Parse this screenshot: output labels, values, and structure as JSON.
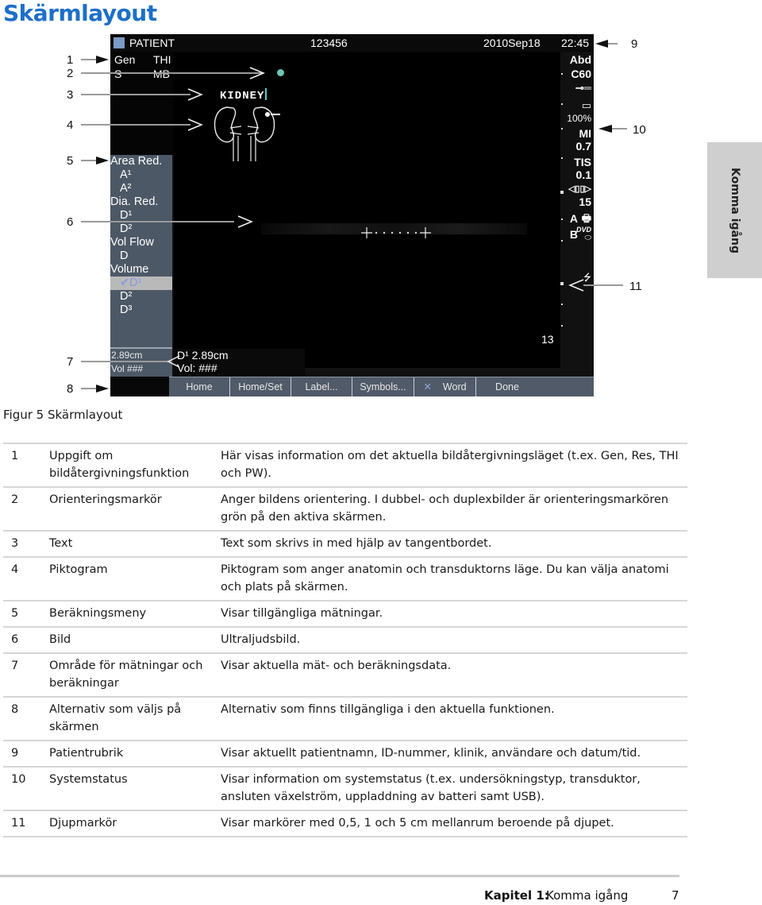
{
  "page": {
    "title": "Skärmlayout",
    "side_tab": "Komma igång",
    "figure_caption": "Figur 5  Skärmlayout",
    "footer": {
      "chapter_label": "Kapitel 1:",
      "chapter_title": "Komma igång",
      "page_number": "7"
    }
  },
  "callouts": [
    "1",
    "2",
    "3",
    "4",
    "5",
    "6",
    "7",
    "8",
    "9",
    "10",
    "11"
  ],
  "screen": {
    "header": {
      "patient": "PATIENT",
      "id": "123456",
      "date": "2010Sep18",
      "time": "22:45"
    },
    "mode_info": {
      "row1": [
        "Gen",
        "THI"
      ],
      "row2": [
        "S",
        "MB"
      ]
    },
    "text_annotation": "KIDNEY",
    "orientation_marker_color": "#6cc8b4",
    "calc_menu": [
      {
        "label": "Area Red.",
        "sub": false,
        "selected": false
      },
      {
        "label": "A¹",
        "sub": true,
        "selected": false
      },
      {
        "label": "A²",
        "sub": true,
        "selected": false
      },
      {
        "label": "Dia. Red.",
        "sub": false,
        "selected": false
      },
      {
        "label": "D¹",
        "sub": true,
        "selected": false
      },
      {
        "label": "D²",
        "sub": true,
        "selected": false
      },
      {
        "label": "Vol Flow",
        "sub": false,
        "selected": false
      },
      {
        "label": "D",
        "sub": true,
        "selected": false
      },
      {
        "label": "Volume",
        "sub": false,
        "selected": false
      },
      {
        "label": "✔D¹",
        "sub": true,
        "selected": true
      },
      {
        "label": "D²",
        "sub": true,
        "selected": false
      },
      {
        "label": "D³",
        "sub": true,
        "selected": false
      }
    ],
    "measurements_left": {
      "line1": "2.89cm",
      "line2": "Vol ###"
    },
    "measurements_main": {
      "line1": "D¹  2.89cm",
      "line2": "Vol: ###"
    },
    "softkeys": [
      "Home",
      "Home/Set",
      "Label...",
      "Symbols...",
      "Word",
      "Done"
    ],
    "system_status": {
      "exam_type": "Abd",
      "transducer": "C60",
      "battery": "100%",
      "mi_label": "MI",
      "mi_value": "0.7",
      "tis_label": "TIS",
      "tis_value": "0.1",
      "depth_value": "15",
      "printer_a": "A",
      "dvd_b": "B",
      "dvd_label": "DVD"
    },
    "frame_number": "13"
  },
  "table": [
    {
      "num": "1",
      "term": "Uppgift om bildåtergivningsfunktion",
      "desc": "Här visas information om det aktuella bildåtergivningsläget (t.ex. Gen, Res, THI och PW)."
    },
    {
      "num": "2",
      "term": "Orienteringsmarkör",
      "desc": "Anger bildens orientering. I dubbel- och duplexbilder är orienteringsmarkören grön på den aktiva skärmen."
    },
    {
      "num": "3",
      "term": "Text",
      "desc": "Text som skrivs in med hjälp av tangentbordet."
    },
    {
      "num": "4",
      "term": "Piktogram",
      "desc": "Piktogram som anger anatomin och transduktorns läge. Du kan välja anatomi och plats på skärmen."
    },
    {
      "num": "5",
      "term": "Beräkningsmeny",
      "desc": "Visar tillgängliga mätningar."
    },
    {
      "num": "6",
      "term": "Bild",
      "desc": "Ultraljudsbild."
    },
    {
      "num": "7",
      "term": "Område för mätningar och beräkningar",
      "desc": "Visar aktuella mät- och beräkningsdata."
    },
    {
      "num": "8",
      "term": "Alternativ som väljs på skärmen",
      "desc": "Alternativ som finns tillgängliga i den aktuella funktionen."
    },
    {
      "num": "9",
      "term": "Patientrubrik",
      "desc": "Visar aktuellt patientnamn, ID-nummer, klinik, användare och datum/tid."
    },
    {
      "num": "10",
      "term": "Systemstatus",
      "desc": "Visar information om systemstatus (t.ex. undersökningstyp, transduktor, ansluten växelström, uppladdning av batteri samt USB)."
    },
    {
      "num": "11",
      "term": "Djupmarkör",
      "desc": "Visar markörer med 0,5, 1 och 5 cm mellanrum beroende på djupet."
    }
  ]
}
